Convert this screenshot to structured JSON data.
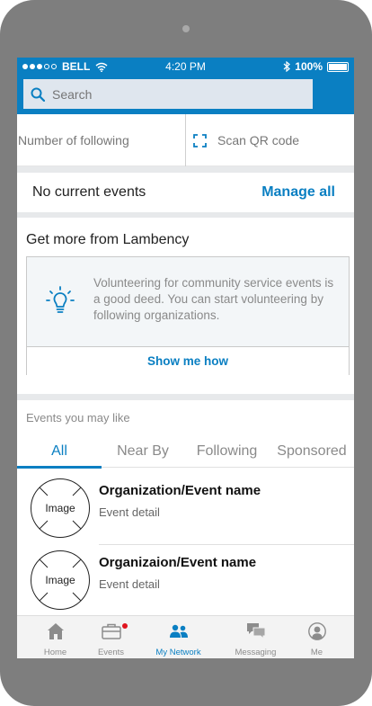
{
  "status_bar": {
    "carrier": "BELL",
    "time": "4:20 PM",
    "battery": "100%",
    "battery_level": 1.0,
    "signal_dots_filled": 3,
    "signal_dots_total": 5
  },
  "search": {
    "placeholder": "Search"
  },
  "quick_actions": {
    "following_label": "Number of following",
    "scan_label": "Scan QR code"
  },
  "events": {
    "empty_label": "No current events",
    "manage_label": "Manage all"
  },
  "promo": {
    "title": "Get more from Lambency",
    "body": "Volunteering for community service events is a good deed. You can start volunteering by following organizations.",
    "action_label": "Show me how"
  },
  "suggestions": {
    "title": "Events you may like",
    "tabs": [
      {
        "label": "All",
        "active": true
      },
      {
        "label": "Near By",
        "active": false
      },
      {
        "label": "Following",
        "active": false
      },
      {
        "label": "Sponsored",
        "active": false
      }
    ],
    "items": [
      {
        "image_label": "Image",
        "name": "Organization/Event name",
        "detail": "Event detail"
      },
      {
        "image_label": "Image",
        "name": "Organizaion/Event name",
        "detail": "Event detail"
      }
    ]
  },
  "bottom_nav": {
    "items": [
      {
        "label": "Home",
        "icon": "home-icon",
        "active": false
      },
      {
        "label": "Events",
        "icon": "briefcase-icon",
        "active": false,
        "badge": true
      },
      {
        "label": "My Network",
        "icon": "people-icon",
        "active": true
      },
      {
        "label": "Messaging",
        "icon": "chat-bubbles-icon",
        "active": false
      },
      {
        "label": "Me",
        "icon": "avatar-icon",
        "active": false
      }
    ]
  },
  "colors": {
    "accent": "#0a7fc2",
    "badge": "#e0141e",
    "frame": "#7e7e7e"
  }
}
